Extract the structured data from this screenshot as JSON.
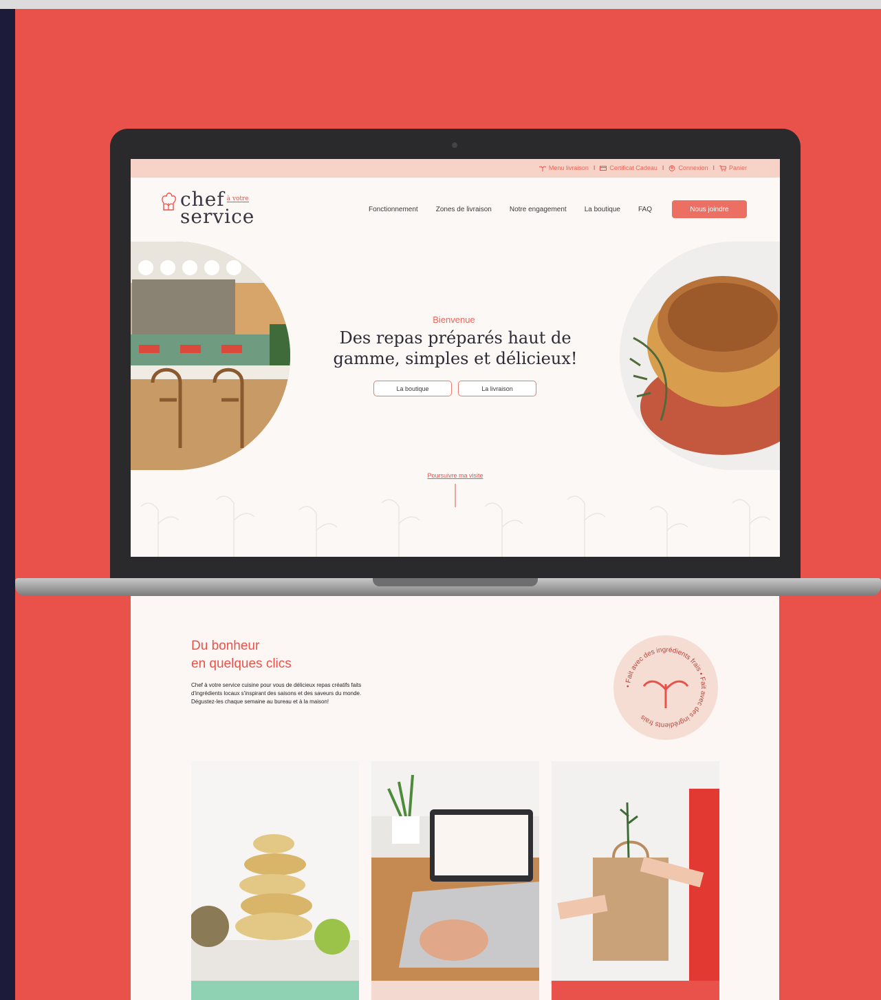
{
  "topbar": {
    "links": [
      {
        "label": "Menu livraison",
        "icon": "sprout-icon"
      },
      {
        "label": "Certificat Cadeau",
        "icon": "card-icon"
      },
      {
        "label": "Connexion",
        "icon": "user-icon"
      },
      {
        "label": "Panier",
        "icon": "cart-icon"
      }
    ],
    "separator": "I"
  },
  "logo": {
    "word_top": "chef",
    "word_small": "à votre",
    "word_bottom": "service"
  },
  "nav": {
    "items": [
      "Fonctionnement",
      "Zones de livraison",
      "Notre engagement",
      "La boutique",
      "FAQ"
    ],
    "cta": "Nous joindre"
  },
  "hero": {
    "eyebrow": "Bienvenue",
    "title": "Des repas préparés haut de gamme, simples et délicieux!",
    "button_shop": "La boutique",
    "button_delivery": "La livraison",
    "continue_link": "Poursuivre ma visite"
  },
  "section": {
    "heading_line1": "Du bonheur",
    "heading_line2": "en quelques clics",
    "body": "Chef à votre service cuisine pour vous de délicieux repas créatifs faits d'ingrédients locaux s'inspirant des saisons et des saveurs du monde. Dégustez-les chaque semaine au bureau et à la maison!",
    "badge_text": "• Fait avec des ingrédients frais • Fait avec des ingrédients frais"
  },
  "colors": {
    "brand_red": "#e8524a",
    "accent_coral": "#eb6f63",
    "topbar_pink": "#f7d3c7",
    "card1_band": "#8fd1b3",
    "card2_band": "#f3d9cf",
    "card3_band": "#e8524a"
  }
}
